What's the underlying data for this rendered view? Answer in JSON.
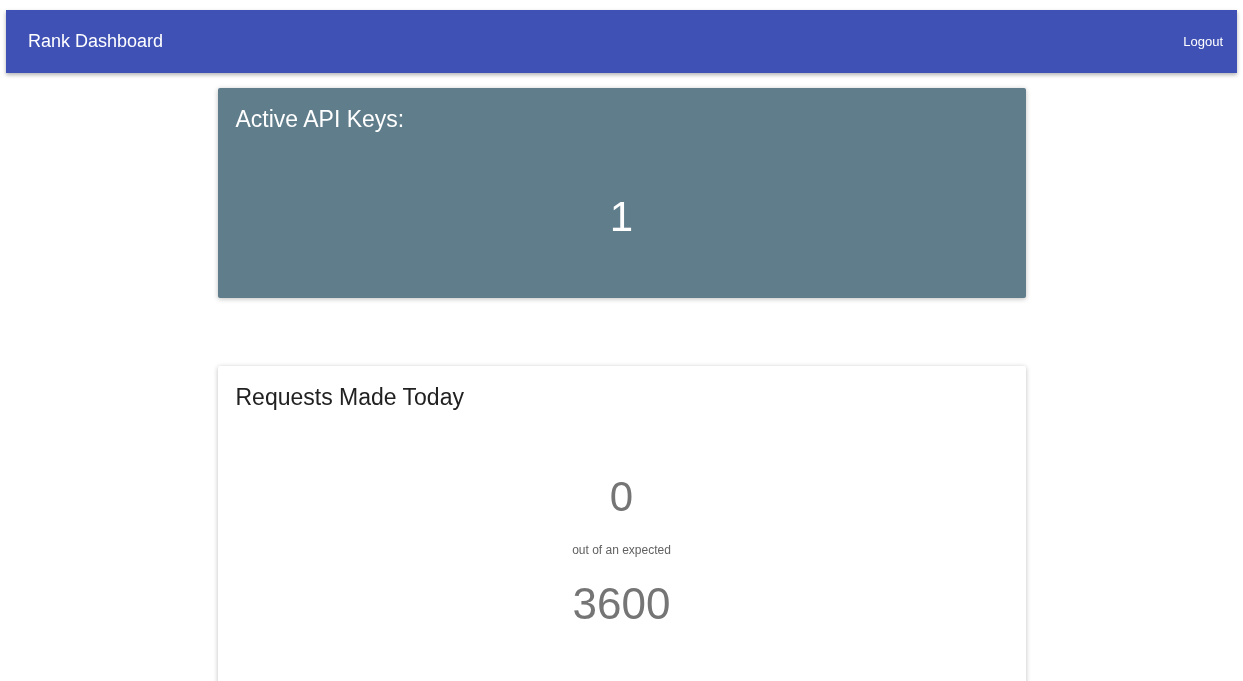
{
  "app_bar": {
    "title": "Rank Dashboard",
    "logout": "Logout"
  },
  "cards": [
    {
      "kind": "dark",
      "title": "Active API Keys:",
      "value": "1"
    },
    {
      "kind": "light",
      "title": "Requests Made Today",
      "value": "0",
      "caption": "out of an expected",
      "expected": "3600"
    }
  ]
}
